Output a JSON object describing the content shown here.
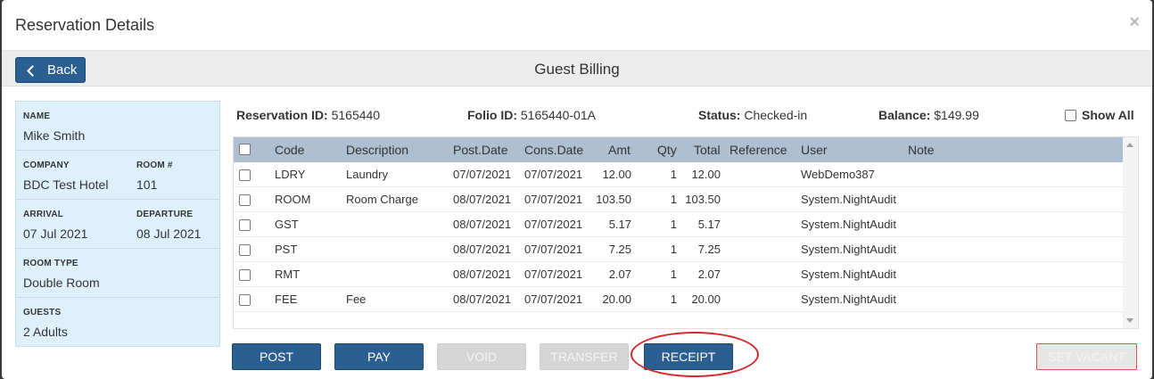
{
  "modal": {
    "title": "Reservation Details",
    "close_glyph": "×"
  },
  "toolbar": {
    "back_label": "Back",
    "title": "Guest Billing"
  },
  "guest": {
    "name_label": "NAME",
    "name": "Mike Smith",
    "company_label": "COMPANY",
    "company": "BDC Test Hotel",
    "room_label": "ROOM #",
    "room": "101",
    "arrival_label": "ARRIVAL",
    "arrival": "07 Jul 2021",
    "departure_label": "DEPARTURE",
    "departure": "08 Jul 2021",
    "room_type_label": "ROOM TYPE",
    "room_type": "Double Room",
    "guests_label": "GUESTS",
    "guests": "2 Adults"
  },
  "info": {
    "reservation_label": "Reservation ID:",
    "reservation_id": "5165440",
    "folio_label": "Folio ID:",
    "folio_id": "5165440-01A",
    "status_label": "Status:",
    "status": "Checked-in",
    "balance_label": "Balance:",
    "balance": "$149.99",
    "show_all_label": "Show All"
  },
  "table": {
    "headers": {
      "code": "Code",
      "description": "Description",
      "post_date": "Post.Date",
      "cons_date": "Cons.Date",
      "amt": "Amt",
      "qty": "Qty",
      "total": "Total",
      "reference": "Reference",
      "user": "User",
      "note": "Note"
    },
    "rows": [
      {
        "code": "LDRY",
        "description": "Laundry",
        "post_date": "07/07/2021",
        "cons_date": "07/07/2021",
        "amt": "12.00",
        "qty": "1",
        "total": "12.00",
        "reference": "",
        "user": "WebDemo387",
        "note": ""
      },
      {
        "code": "ROOM",
        "description": "Room Charge",
        "post_date": "08/07/2021",
        "cons_date": "07/07/2021",
        "amt": "103.50",
        "qty": "1",
        "total": "103.50",
        "reference": "",
        "user": "System.NightAudit",
        "note": ""
      },
      {
        "code": "GST",
        "description": "",
        "post_date": "08/07/2021",
        "cons_date": "07/07/2021",
        "amt": "5.17",
        "qty": "1",
        "total": "5.17",
        "reference": "",
        "user": "System.NightAudit",
        "note": ""
      },
      {
        "code": "PST",
        "description": "",
        "post_date": "08/07/2021",
        "cons_date": "07/07/2021",
        "amt": "7.25",
        "qty": "1",
        "total": "7.25",
        "reference": "",
        "user": "System.NightAudit",
        "note": ""
      },
      {
        "code": "RMT",
        "description": "",
        "post_date": "08/07/2021",
        "cons_date": "07/07/2021",
        "amt": "2.07",
        "qty": "1",
        "total": "2.07",
        "reference": "",
        "user": "System.NightAudit",
        "note": ""
      },
      {
        "code": "FEE",
        "description": "Fee",
        "post_date": "08/07/2021",
        "cons_date": "07/07/2021",
        "amt": "20.00",
        "qty": "1",
        "total": "20.00",
        "reference": "",
        "user": "System.NightAudit",
        "note": ""
      }
    ]
  },
  "actions": {
    "post": "POST",
    "pay": "PAY",
    "void": "VOID",
    "transfer": "TRANSFER",
    "receipt": "RECEIPT",
    "set_vacant": "SET VACANT"
  },
  "colors": {
    "primary": "#2b5f91",
    "highlight": "#d8252b",
    "panel": "#dff0fd",
    "header_row": "#adbfd0"
  }
}
